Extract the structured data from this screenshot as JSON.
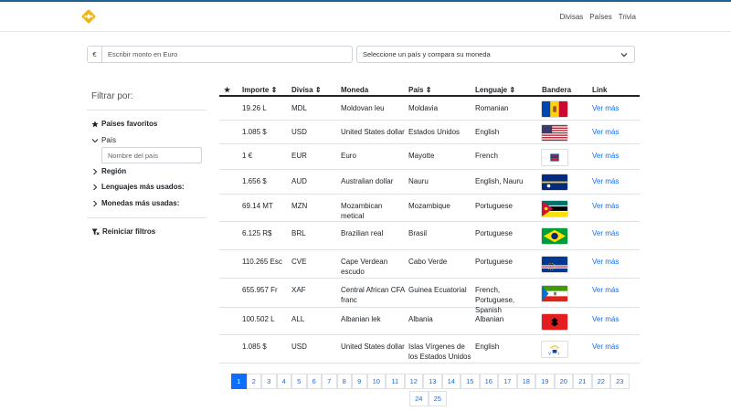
{
  "nav": {
    "items": [
      "Divisas",
      "Países",
      "Trivia"
    ]
  },
  "search": {
    "prefix": "€",
    "placeholder": "Escribir monto en Euro",
    "select_value": "Seleccione un país y compara su moneda"
  },
  "filters": {
    "title": "Filtrar por:",
    "favorites": "Países favoritos",
    "country": "País",
    "country_placeholder": "Nombre del país",
    "region": "Región",
    "languages": "Lenguajes más usados:",
    "currencies": "Monedas más usadas:",
    "reset": "Reiniciar filtros"
  },
  "table": {
    "headers": {
      "fav": "★",
      "amount": "Importe",
      "currency": "Divisa",
      "money": "Moneda",
      "country": "País",
      "language": "Lenguaje",
      "flag": "Bandera",
      "link": "Link"
    },
    "rows": [
      {
        "amount": "19.26 L",
        "code": "MDL",
        "name": "Moldovan leu",
        "country": "Moldavia",
        "language": "Romanian",
        "flag": "moldova",
        "link": "Ver más"
      },
      {
        "amount": "1.085 $",
        "code": "USD",
        "name": "United States dollar",
        "country": "Estados Unidos",
        "language": "English",
        "flag": "usa",
        "link": "Ver más"
      },
      {
        "amount": "1 €",
        "code": "EUR",
        "name": "Euro",
        "country": "Mayotte",
        "language": "French",
        "flag": "mayotte",
        "link": "Ver más"
      },
      {
        "amount": "1.656 $",
        "code": "AUD",
        "name": "Australian dollar",
        "country": "Nauru",
        "language": "English, Nauru",
        "flag": "nauru",
        "link": "Ver más"
      },
      {
        "amount": "69.14 MT",
        "code": "MZN",
        "name": "Mozambican metical",
        "country": "Mozambique",
        "language": "Portuguese",
        "flag": "mozambique",
        "link": "Ver más"
      },
      {
        "amount": "6.125 R$",
        "code": "BRL",
        "name": "Brazilian real",
        "country": "Brasil",
        "language": "Portuguese",
        "flag": "brazil",
        "link": "Ver más"
      },
      {
        "amount": "110.265 Esc",
        "code": "CVE",
        "name": "Cape Verdean escudo",
        "country": "Cabo Verde",
        "language": "Portuguese",
        "flag": "capeverde",
        "link": "Ver más"
      },
      {
        "amount": "655.957 Fr",
        "code": "XAF",
        "name": "Central African CFA franc",
        "country": "Guinea Ecuatorial",
        "language": "French, Portuguese, Spanish",
        "flag": "eqguinea",
        "link": "Ver más"
      },
      {
        "amount": "100.502 L",
        "code": "ALL",
        "name": "Albanian lek",
        "country": "Albania",
        "language": "Albanian",
        "flag": "albania",
        "link": "Ver más"
      },
      {
        "amount": "1.085 $",
        "code": "USD",
        "name": "United States dollar",
        "country": "Islas Vírgenes de los Estados Unidos",
        "language": "English",
        "flag": "usvi",
        "link": "Ver más"
      }
    ]
  },
  "pagination": {
    "pages": [
      "1",
      "2",
      "3",
      "4",
      "5",
      "6",
      "7",
      "8",
      "9",
      "10",
      "11",
      "12",
      "13",
      "14",
      "15",
      "16",
      "17",
      "18",
      "19",
      "20",
      "21",
      "22",
      "23",
      "24",
      "25"
    ],
    "active": "1"
  }
}
